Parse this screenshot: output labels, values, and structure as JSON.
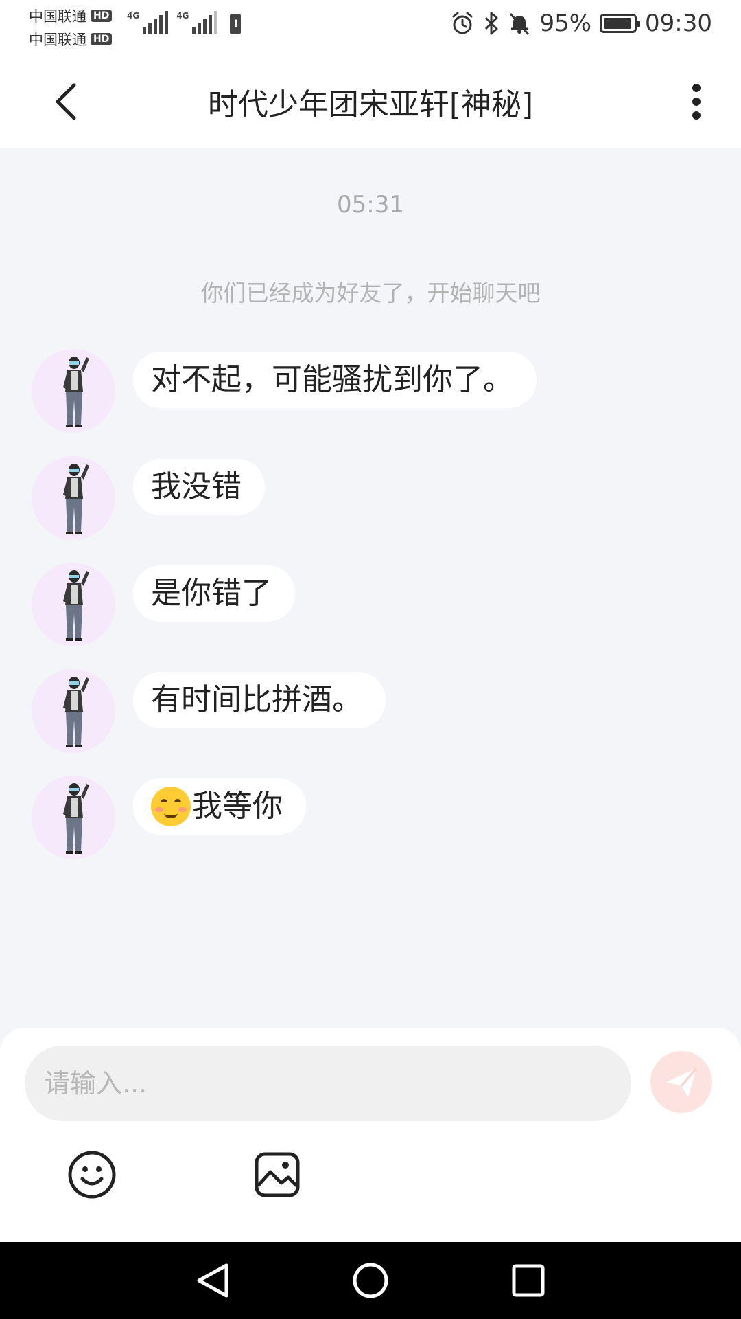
{
  "status_bar": {
    "carrier1": "中国联通",
    "carrier2": "中国联通",
    "hd_label": "HD",
    "network1": "4G",
    "network2": "4G",
    "battery_percent": "95%",
    "battery_level": 0.95,
    "time": "09:30"
  },
  "header": {
    "title": "时代少年团宋亚轩[神秘]"
  },
  "chat": {
    "timestamp": "05:31",
    "system_message": "你们已经成为好友了，开始聊天吧",
    "messages": [
      {
        "text": "对不起，可能骚扰到你了。"
      },
      {
        "text": "我没错"
      },
      {
        "text": "是你错了"
      },
      {
        "text": "有时间比拼酒。"
      },
      {
        "text": "我等你",
        "emoji": "smiling-face-emoji"
      }
    ]
  },
  "composer": {
    "placeholder": "请输入...",
    "value": ""
  },
  "icons": {
    "back": "chevron-left-icon",
    "more": "more-vertical-icon",
    "send": "send-plane-icon",
    "emoji": "smiley-icon",
    "image": "image-icon"
  },
  "colors": {
    "chat_background": "#f4f5f8",
    "bubble": "#ffffff",
    "send_button": "#fde3df",
    "avatar_background": "#f6e9fb"
  }
}
